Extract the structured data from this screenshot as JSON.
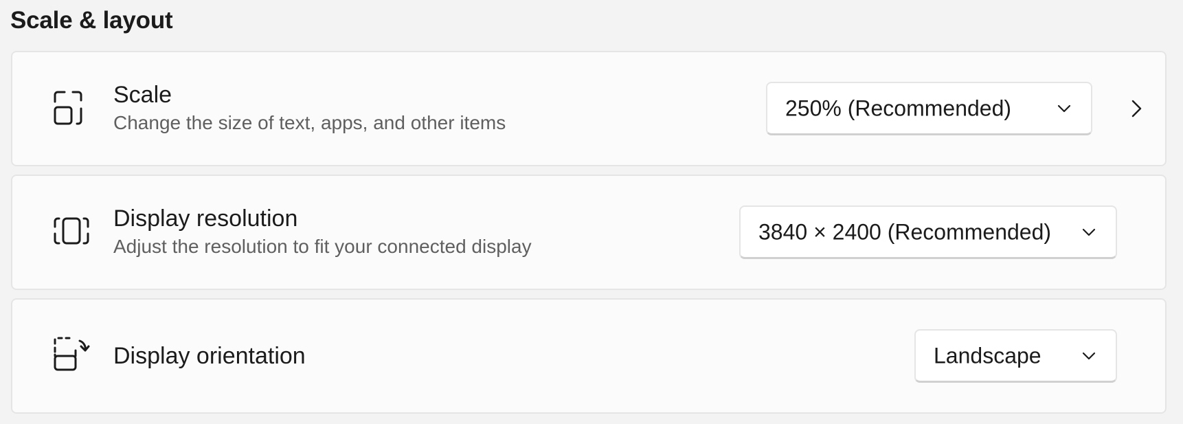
{
  "section": {
    "title": "Scale & layout"
  },
  "settings": [
    {
      "icon": "scale-icon",
      "title": "Scale",
      "description": "Change the size of text, apps, and other items",
      "dropdown_value": "250% (Recommended)",
      "has_expand_chevron": true
    },
    {
      "icon": "display-resolution-icon",
      "title": "Display resolution",
      "description": "Adjust the resolution to fit your connected display",
      "dropdown_value": "3840 × 2400 (Recommended)"
    },
    {
      "icon": "display-orientation-icon",
      "title": "Display orientation",
      "dropdown_value": "Landscape"
    }
  ],
  "colors": {
    "page_background": "#f3f3f3",
    "card_background": "#fbfbfb",
    "card_border": "#e5e5e5",
    "primary_text": "#1b1b1b",
    "secondary_text": "#5f5f5f"
  }
}
